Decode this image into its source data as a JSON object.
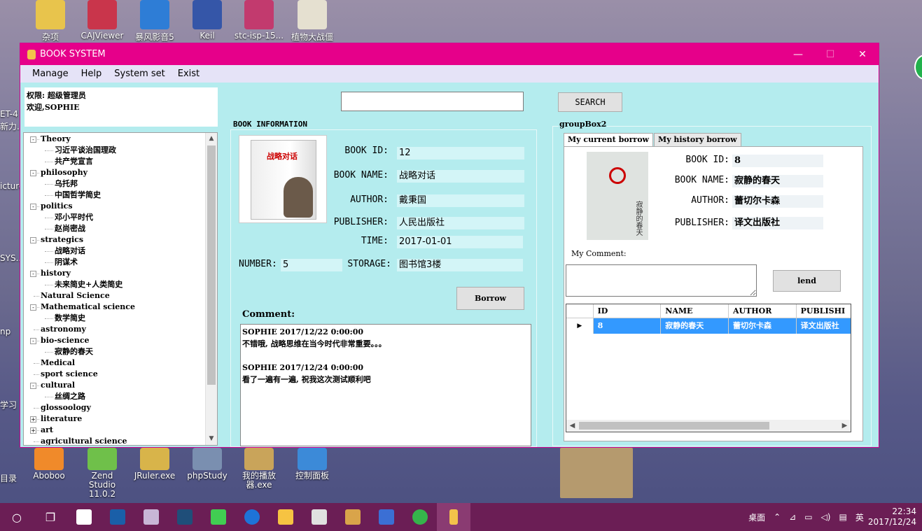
{
  "desktop": {
    "top_icons": [
      "杂项",
      "CAJViewer",
      "暴风影音5",
      "Keil",
      "stc-isp-15...",
      "植物大战僵"
    ],
    "bottom_icons": [
      "Aboboo",
      "Zend Studio 11.0.2",
      "JRuler.exe",
      "phpStudy",
      "我的播放器.exe",
      "控制面板"
    ],
    "left_edge": [
      "ET-4",
      "新力...",
      "icture",
      "SYS...",
      "np",
      "学习",
      "目录"
    ]
  },
  "window": {
    "title": "BOOK SYSTEM",
    "menu": [
      "Manage",
      "Help",
      "System set",
      "Exist"
    ],
    "controls": {
      "minimize": "—",
      "maximize": "☐",
      "close": "✕"
    }
  },
  "user": {
    "permission": "权限: 超级管理员",
    "welcome": "欢迎,SOPHIE"
  },
  "tree": [
    {
      "label": "Theory",
      "level": 0,
      "expander": "-"
    },
    {
      "label": "习近平谈治国理政",
      "level": 1
    },
    {
      "label": "共产党宣言",
      "level": 1
    },
    {
      "label": "philosophy",
      "level": 0,
      "expander": "-"
    },
    {
      "label": "乌托邦",
      "level": 1
    },
    {
      "label": "中国哲学简史",
      "level": 1
    },
    {
      "label": "politics",
      "level": 0,
      "expander": "-"
    },
    {
      "label": "邓小平时代",
      "level": 1
    },
    {
      "label": "赵尚密战",
      "level": 1
    },
    {
      "label": "strategics",
      "level": 0,
      "expander": "-"
    },
    {
      "label": "战略对话",
      "level": 1
    },
    {
      "label": "阴谋术",
      "level": 1
    },
    {
      "label": "history",
      "level": 0,
      "expander": "-"
    },
    {
      "label": "未来简史+人类简史",
      "level": 1
    },
    {
      "label": "Natural Science",
      "level": 0,
      "expander": ""
    },
    {
      "label": "Mathematical science",
      "level": 0,
      "expander": "-"
    },
    {
      "label": "数学简史",
      "level": 1
    },
    {
      "label": "astronomy",
      "level": 0,
      "expander": ""
    },
    {
      "label": "bio-science",
      "level": 0,
      "expander": "-"
    },
    {
      "label": "寂静的春天",
      "level": 1
    },
    {
      "label": "Medical",
      "level": 0,
      "expander": ""
    },
    {
      "label": "sport science",
      "level": 0,
      "expander": ""
    },
    {
      "label": "cultural",
      "level": 0,
      "expander": "-"
    },
    {
      "label": "丝绸之路",
      "level": 1
    },
    {
      "label": "glossoology",
      "level": 0,
      "expander": ""
    },
    {
      "label": "literature",
      "level": 0,
      "expander": "+"
    },
    {
      "label": "art",
      "level": 0,
      "expander": "+"
    },
    {
      "label": "agricultural science",
      "level": 0,
      "expander": ""
    }
  ],
  "search": {
    "value": "",
    "button": "SEARCH"
  },
  "book_info": {
    "group_title": "BOOK INFORMATION",
    "cover_title": "战略对话",
    "cover_subtitle": "戴秉国回忆录",
    "labels": {
      "id": "BOOK ID:",
      "name": "BOOK NAME:",
      "author": "AUTHOR:",
      "publisher": "PUBLISHER:",
      "time": "TIME:",
      "number": "NUMBER:",
      "storage": "STORAGE:"
    },
    "values": {
      "id": "12",
      "name": "战略对话",
      "author": "戴秉国",
      "publisher": "人民出版社",
      "time": "2017-01-01",
      "number": "5",
      "storage": "图书馆3楼"
    },
    "borrow_button": "Borrow",
    "comment_label": "Comment:",
    "comments": [
      {
        "header": "SOPHIE      2017/12/22 0:00:00",
        "text": "不错哦, 战略思维在当今时代非常重要。。。"
      },
      {
        "header": "SOPHIE      2017/12/24 0:00:00",
        "text": "看了一遍有一遍, 祝我这次测试顺利吧"
      }
    ]
  },
  "group2": {
    "title": "groupBox2",
    "tabs": [
      "My current borrow",
      "My history borrow"
    ],
    "active_tab": 0,
    "cover_title": "寂静的春天",
    "labels": {
      "id": "BOOK ID:",
      "name": "BOOK NAME:",
      "author": "AUTHOR:",
      "publisher": "PUBLISHER:"
    },
    "values": {
      "id": "8",
      "name": "寂静的春天",
      "author": "蕾切尔卡森",
      "publisher": "译文出版社"
    },
    "my_comment_label": "My Comment:",
    "my_comment_value": "",
    "lend_button": "lend",
    "grid": {
      "columns": [
        "ID",
        "NAME",
        "AUTHOR",
        "PUBLISHI"
      ],
      "rows": [
        {
          "id": "8",
          "name": "寂静的春天",
          "author": "蕾切尔卡森",
          "publisher": "译文出版社"
        }
      ]
    }
  },
  "taskbar": {
    "tray_text": "桌面",
    "ime": "英",
    "time": "22:34",
    "date": "2017/12/24"
  }
}
